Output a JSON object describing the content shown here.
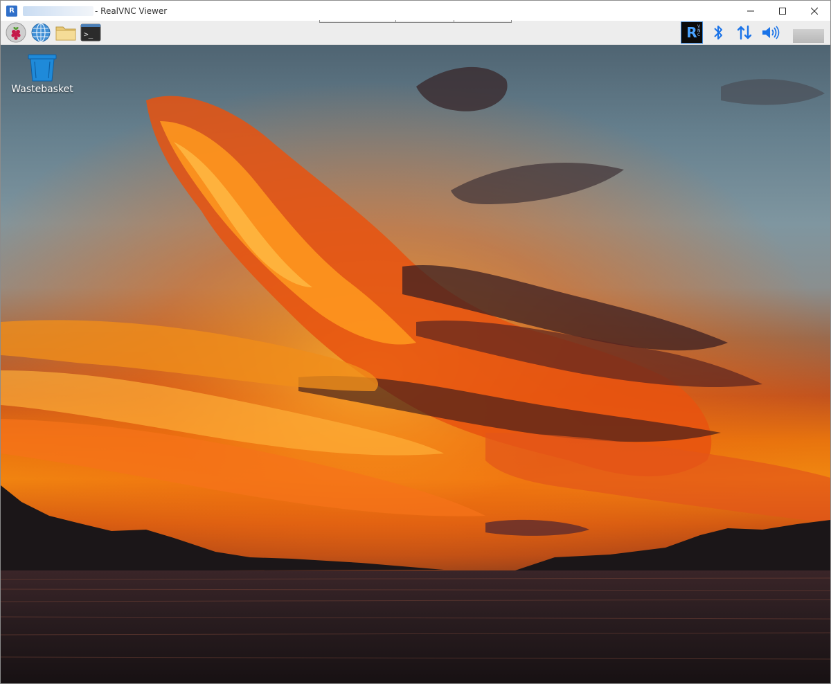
{
  "window": {
    "title": "- RealVNC Viewer",
    "app_icon": "realvnc-logo-icon",
    "controls": [
      "minimize-icon",
      "maximize-icon",
      "close-icon"
    ]
  },
  "panel": {
    "launchers": [
      {
        "name": "raspberry-menu",
        "icon": "raspberry-pi-icon"
      },
      {
        "name": "web-browser",
        "icon": "globe-icon"
      },
      {
        "name": "file-manager",
        "icon": "folder-icon"
      },
      {
        "name": "terminal",
        "icon": "terminal-icon",
        "label": ">_"
      }
    ],
    "tray": [
      {
        "name": "vnc-server",
        "icon": "realvnc-tray-icon",
        "label": "R",
        "sub": "V N C"
      },
      {
        "name": "bluetooth",
        "icon": "bluetooth-icon"
      },
      {
        "name": "network",
        "icon": "network-updown-icon"
      },
      {
        "name": "volume",
        "icon": "speaker-icon"
      }
    ]
  },
  "desktop": {
    "icons": [
      {
        "label": "Wastebasket",
        "icon": "trash-bin-icon"
      }
    ],
    "wallpaper": "sunset-over-lake-clouds"
  },
  "colors": {
    "bin_blue": "#1f8ad9",
    "tray_blue": "#1a73e8",
    "sunset_orange": "#f18710"
  }
}
